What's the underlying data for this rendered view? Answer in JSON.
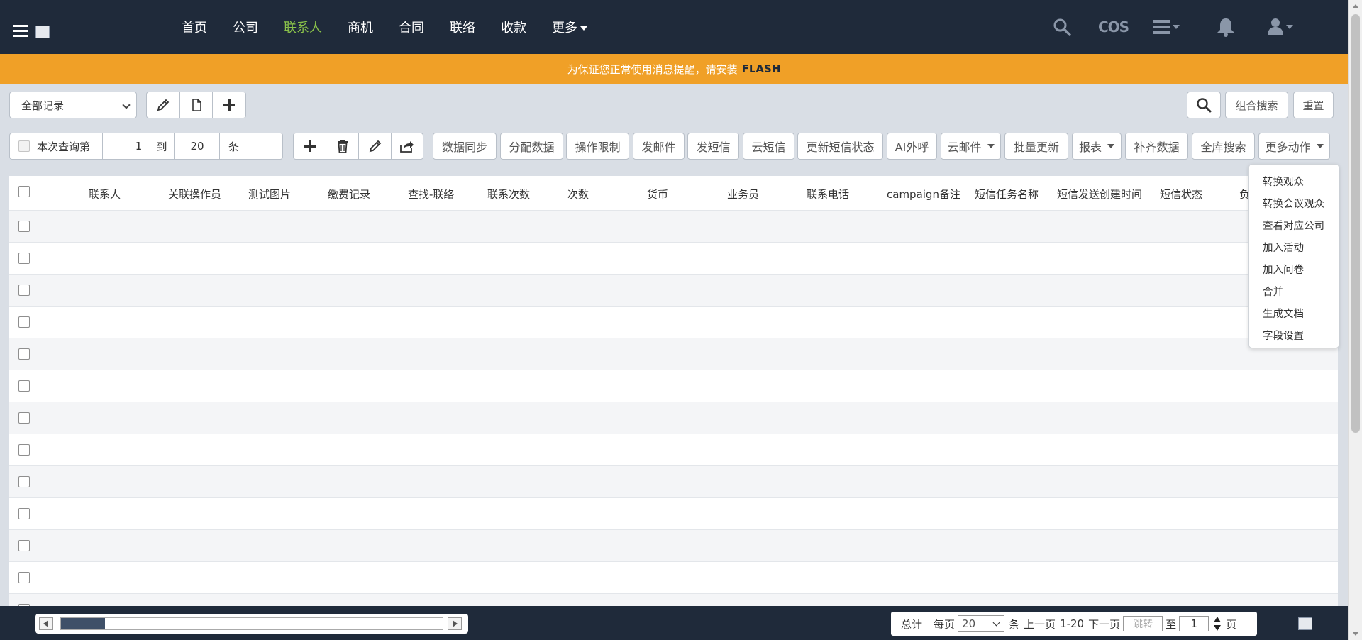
{
  "nav": {
    "items": [
      {
        "label": "首页",
        "active": false
      },
      {
        "label": "公司",
        "active": false
      },
      {
        "label": "联系人",
        "active": true
      },
      {
        "label": "商机",
        "active": false
      },
      {
        "label": "合同",
        "active": false
      },
      {
        "label": "联络",
        "active": false
      },
      {
        "label": "收款",
        "active": false
      },
      {
        "label": "更多",
        "active": false
      }
    ],
    "cos_label": "COS"
  },
  "banner": {
    "text": "为保证您正常使用消息提醒，请安装",
    "highlight": "FLASH"
  },
  "toolbar": {
    "view_select": "全部记录",
    "combo_search": "组合搜索",
    "reset": "重置"
  },
  "range": {
    "label": "本次查询第",
    "from": "1",
    "to_label": "到",
    "to": "20",
    "unit": "条"
  },
  "actions": {
    "data_sync": "数据同步",
    "assign_data": "分配数据",
    "op_limit": "操作限制",
    "send_email": "发邮件",
    "send_sms": "发短信",
    "cloud_sms": "云短信",
    "update_sms_status": "更新短信状态",
    "ai_call": "AI外呼",
    "cloud_email": "云邮件",
    "batch_update": "批量更新",
    "report": "报表",
    "fill_data": "补齐数据",
    "global_search": "全库搜索",
    "more_actions": "更多动作"
  },
  "table": {
    "columns": [
      "联系人",
      "关联操作员",
      "测试图片",
      "缴费记录",
      "查找-联络",
      "联系次数",
      "次数",
      "货币",
      "业务员",
      "联系电话",
      "campaign备注",
      "短信任务名称",
      "短信发送创建时间",
      "短信状态",
      "负"
    ],
    "row_count": 13
  },
  "more_menu": [
    "转换观众",
    "转换会议观众",
    "查看对应公司",
    "加入活动",
    "加入问卷",
    "合并",
    "生成文档",
    "字段设置"
  ],
  "pager": {
    "total_label": "总计",
    "per_page_label": "每页",
    "per_page": "20",
    "unit": "条",
    "prev": "上一页",
    "range": "1-20",
    "next": "下一页",
    "jump_placeholder": "跳转",
    "to_label": "至",
    "page": "1",
    "page_unit": "页"
  },
  "colors": {
    "nav_bg": "#1f2a3a",
    "nav_active": "#8bc34a",
    "banner_bg": "#f0a027",
    "page_bg": "#d9dee5"
  }
}
